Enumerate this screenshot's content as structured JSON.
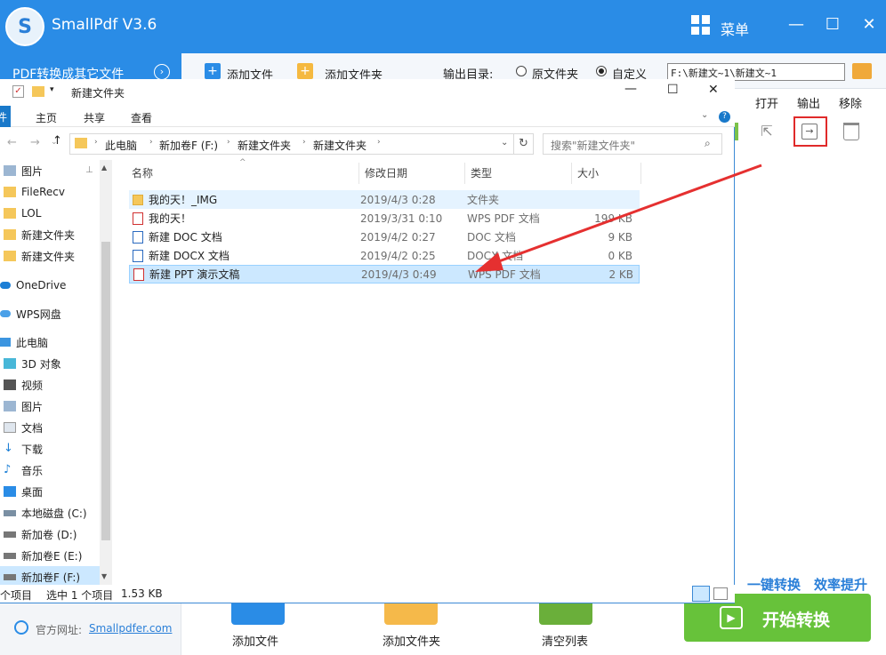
{
  "app": {
    "title": "SmallPdf V3.6",
    "logo_letter": "S",
    "menu_label": "菜单",
    "tab_label": "PDF转换成其它文件",
    "toolbar": {
      "add_file": "添加文件",
      "add_folder": "添加文件夹",
      "output_dir_label": "输出目录:",
      "radio_original": "原文件夹",
      "radio_custom": "自定义",
      "output_path": "F:\\新建文~1\\新建文~1"
    },
    "columns": {
      "open": "打开",
      "output": "输出",
      "remove": "移除"
    },
    "slogan_1": "一键转换",
    "slogan_2": "效率提升",
    "start_button": "开始转换",
    "website_label": "官方网址:",
    "website": "Smallpdfer.com",
    "bottom": {
      "add_file": "添加文件",
      "add_folder": "添加文件夹",
      "clear": "清空列表"
    },
    "accent": "#2a8ce6",
    "green": "#67c23a"
  },
  "explorer": {
    "title": "新建文件夹",
    "ribbon": {
      "file": "件",
      "home": "主页",
      "share": "共享",
      "view": "查看"
    },
    "breadcrumb": [
      "此电脑",
      "新加卷F (F:)",
      "新建文件夹",
      "新建文件夹"
    ],
    "search_placeholder": "搜索\"新建文件夹\"",
    "columns": {
      "name": "名称",
      "date": "修改日期",
      "type": "类型",
      "size": "大小"
    },
    "nav": [
      "图片",
      "FileRecv",
      "LOL",
      "新建文件夹",
      "新建文件夹",
      "OneDrive",
      "WPS网盘",
      "此电脑",
      "3D 对象",
      "视频",
      "图片",
      "文档",
      "下载",
      "音乐",
      "桌面",
      "本地磁盘 (C:)",
      "新加卷 (D:)",
      "新加卷E (E:)",
      "新加卷F (F:)"
    ],
    "files": [
      {
        "name": "我的天！_IMG",
        "date": "2019/4/3 0:28",
        "type": "文件夹",
        "size": "",
        "icon": "folder-icon"
      },
      {
        "name": "我的天！",
        "date": "2019/3/31 0:10",
        "type": "WPS PDF 文档",
        "size": "199 KB",
        "icon": "pdf-icon"
      },
      {
        "name": "新建 DOC 文档",
        "date": "2019/4/2 0:27",
        "type": "DOC 文档",
        "size": "9 KB",
        "icon": "word-icon"
      },
      {
        "name": "新建 DOCX 文档",
        "date": "2019/4/2 0:25",
        "type": "DOCX 文档",
        "size": "0 KB",
        "icon": "word-icon"
      },
      {
        "name": "新建 PPT 演示文稿",
        "date": "2019/4/3 0:49",
        "type": "WPS PDF 文档",
        "size": "2 KB",
        "icon": "pdf-icon"
      }
    ],
    "status": {
      "count": "个项目",
      "selected": "选中 1 个项目",
      "size": "1.53 KB"
    }
  }
}
